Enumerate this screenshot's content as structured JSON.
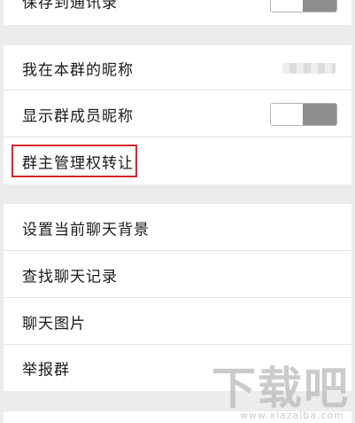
{
  "settings": {
    "items": [
      {
        "label": "保存到通讯录"
      },
      {
        "label": "我在本群的昵称"
      },
      {
        "label": "显示群成员昵称"
      },
      {
        "label": "群主管理权转让"
      },
      {
        "label": "设置当前聊天背景"
      },
      {
        "label": "查找聊天记录"
      },
      {
        "label": "聊天图片"
      },
      {
        "label": "举报群"
      }
    ],
    "save_to_contacts_toggle": "off",
    "show_member_nickname_toggle": "off"
  },
  "colors": {
    "highlight": "#d8262c",
    "toggle_fill": "#8d8d8d",
    "background": "#ececec"
  },
  "watermark": {
    "main": "下载吧",
    "sub": "www.xiazaiba.com"
  }
}
